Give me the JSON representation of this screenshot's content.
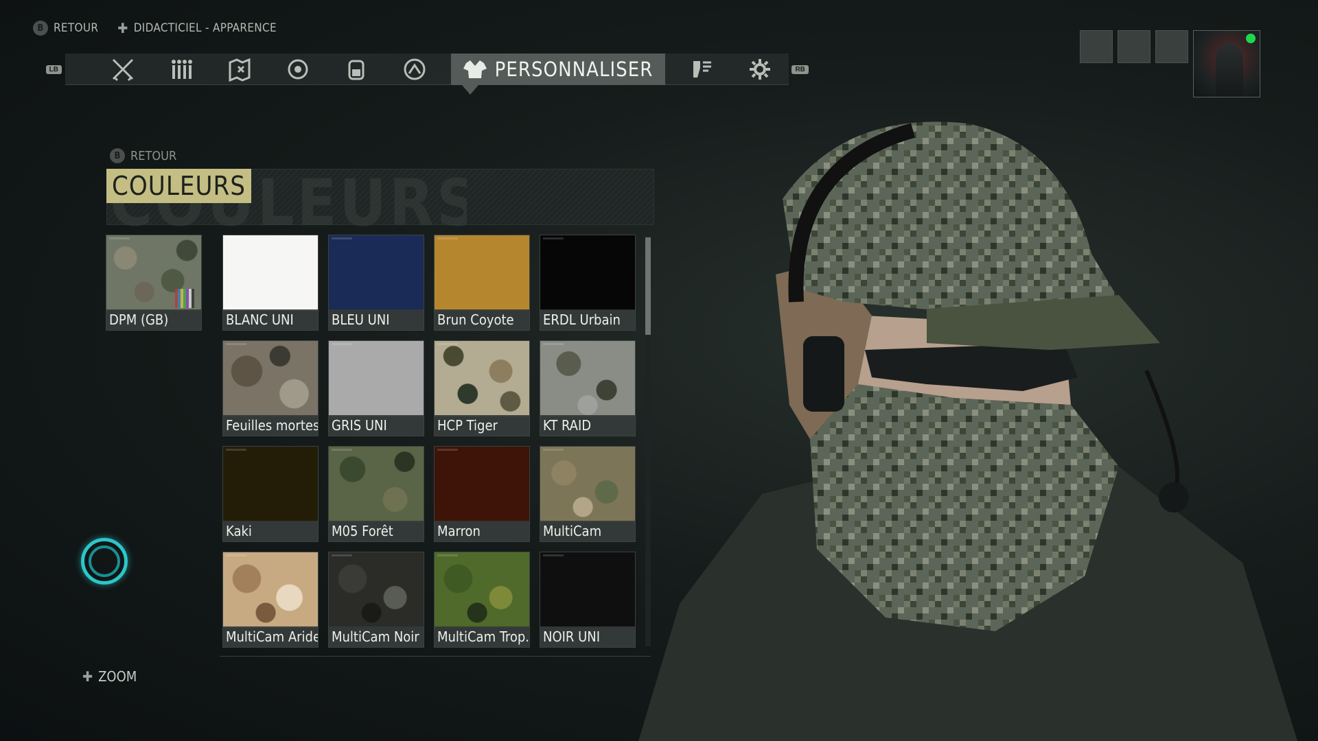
{
  "hints": [
    {
      "button": "B",
      "label": "RETOUR"
    },
    {
      "button": "✚",
      "label": "DIDACTICIEL - APPARENCE"
    }
  ],
  "nav": {
    "left_bumper": "LB",
    "right_bumper": "RB",
    "active_label": "PERSONNALISER",
    "icons": [
      "weapons-icon",
      "team-icon",
      "map-icon",
      "target-icon",
      "backpack-icon",
      "skills-icon",
      "intel-icon",
      "settings-icon"
    ]
  },
  "panel": {
    "back_label": "RETOUR",
    "back_button": "B",
    "title": "COULEURS",
    "title_ghost": "COULEURS",
    "selected": {
      "label": "DPM (GB)"
    },
    "items": [
      {
        "label": "BLANC UNI"
      },
      {
        "label": "BLEU UNI"
      },
      {
        "label": "Brun Coyote"
      },
      {
        "label": "ERDL Urbain"
      },
      {
        "label": "Feuilles mortes"
      },
      {
        "label": "GRIS UNI"
      },
      {
        "label": "HCP Tiger"
      },
      {
        "label": "KT RAID"
      },
      {
        "label": "Kaki"
      },
      {
        "label": "M05 Forêt"
      },
      {
        "label": "Marron"
      },
      {
        "label": "MultiCam"
      },
      {
        "label": "MultiCam Aride"
      },
      {
        "label": "MultiCam Noir"
      },
      {
        "label": "MultiCam Trop..."
      },
      {
        "label": "NOIR UNI"
      }
    ]
  },
  "zoom": {
    "button": "✚",
    "label": "ZOOM"
  },
  "colors": {
    "accent": "#c4be84",
    "spinner": "#2dc6c9",
    "online": "#1fd84a"
  }
}
